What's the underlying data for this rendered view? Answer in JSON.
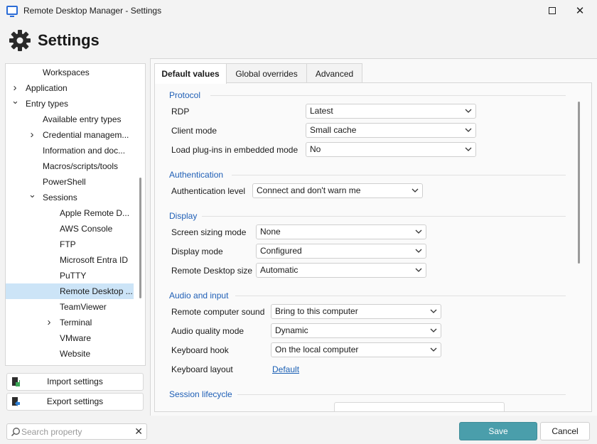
{
  "window": {
    "title": "Remote Desktop Manager - Settings"
  },
  "header": {
    "title": "Settings"
  },
  "tree": [
    {
      "label": "Workspaces",
      "level": 2,
      "chevron": ""
    },
    {
      "label": "Application",
      "level": 1,
      "chevron": "right"
    },
    {
      "label": "Entry types",
      "level": 1,
      "chevron": "down"
    },
    {
      "label": "Available entry types",
      "level": 2,
      "chevron": ""
    },
    {
      "label": "Credential managem...",
      "level": 2,
      "chevron": "right"
    },
    {
      "label": "Information and doc...",
      "level": 2,
      "chevron": ""
    },
    {
      "label": "Macros/scripts/tools",
      "level": 2,
      "chevron": ""
    },
    {
      "label": "PowerShell",
      "level": 2,
      "chevron": ""
    },
    {
      "label": "Sessions",
      "level": 2,
      "chevron": "down"
    },
    {
      "label": "Apple Remote D...",
      "level": 3,
      "chevron": ""
    },
    {
      "label": "AWS Console",
      "level": 3,
      "chevron": ""
    },
    {
      "label": "FTP",
      "level": 3,
      "chevron": ""
    },
    {
      "label": "Microsoft Entra ID",
      "level": 3,
      "chevron": ""
    },
    {
      "label": "PuTTY",
      "level": 3,
      "chevron": ""
    },
    {
      "label": "Remote Desktop ...",
      "level": 3,
      "chevron": "",
      "selected": true
    },
    {
      "label": "TeamViewer",
      "level": 3,
      "chevron": ""
    },
    {
      "label": "Terminal",
      "level": 3,
      "chevron": "right"
    },
    {
      "label": "VMware",
      "level": 3,
      "chevron": ""
    },
    {
      "label": "Website",
      "level": 3,
      "chevron": ""
    }
  ],
  "side_buttons": {
    "import": "Import settings",
    "export": "Export settings"
  },
  "search": {
    "placeholder": "Search property",
    "value": ""
  },
  "tabs": [
    "Default values",
    "Global overrides",
    "Advanced"
  ],
  "sections": {
    "protocol": {
      "title": "Protocol",
      "rdp": {
        "label": "RDP",
        "value": "Latest"
      },
      "client_mode": {
        "label": "Client mode",
        "value": "Small cache"
      },
      "plugins": {
        "label": "Load plug-ins in embedded mode",
        "value": "No"
      }
    },
    "authentication": {
      "title": "Authentication",
      "level": {
        "label": "Authentication level",
        "value": "Connect and don't warn me"
      }
    },
    "display": {
      "title": "Display",
      "sizing": {
        "label": "Screen sizing mode",
        "value": "None"
      },
      "mode": {
        "label": "Display mode",
        "value": "Configured"
      },
      "size": {
        "label": "Remote Desktop size",
        "value": "Automatic"
      }
    },
    "audio": {
      "title": "Audio and input",
      "sound": {
        "label": "Remote computer sound",
        "value": "Bring to this computer"
      },
      "quality": {
        "label": "Audio quality mode",
        "value": "Dynamic"
      },
      "hook": {
        "label": "Keyboard hook",
        "value": "On the local computer"
      },
      "layout": {
        "label": "Keyboard layout",
        "value": "Default"
      }
    },
    "lifecycle": {
      "title": "Session lifecycle"
    }
  },
  "footer": {
    "save": "Save",
    "cancel": "Cancel"
  },
  "colors": {
    "accent": "#4a9eab",
    "section": "#1f5fb6",
    "selected": "#cce4f7"
  }
}
